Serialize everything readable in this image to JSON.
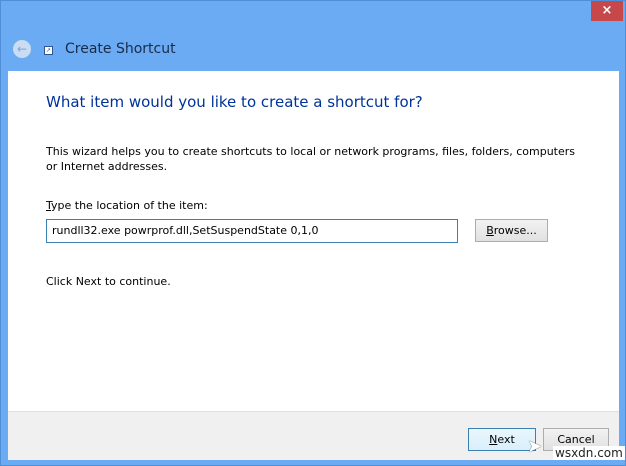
{
  "window": {
    "title": "Create Shortcut",
    "close_label": "×",
    "back_label": "←",
    "icon": "shortcut-icon"
  },
  "content": {
    "heading": "What item would you like to create a shortcut for?",
    "description": "This wizard helps you to create shortcuts to local or network programs, files, folders, computers or Internet addresses.",
    "location_label_first": "T",
    "location_label_rest": "ype the location of the item:",
    "location_value": "rundll32.exe powrprof.dll,SetSuspendState 0,1,0",
    "browse_first": "B",
    "browse_rest": "rowse...",
    "continue_text": "Click Next to continue."
  },
  "footer": {
    "next_first": "N",
    "next_rest": "ext",
    "cancel_label": "Cancel"
  },
  "watermark": "wsxdn.com"
}
